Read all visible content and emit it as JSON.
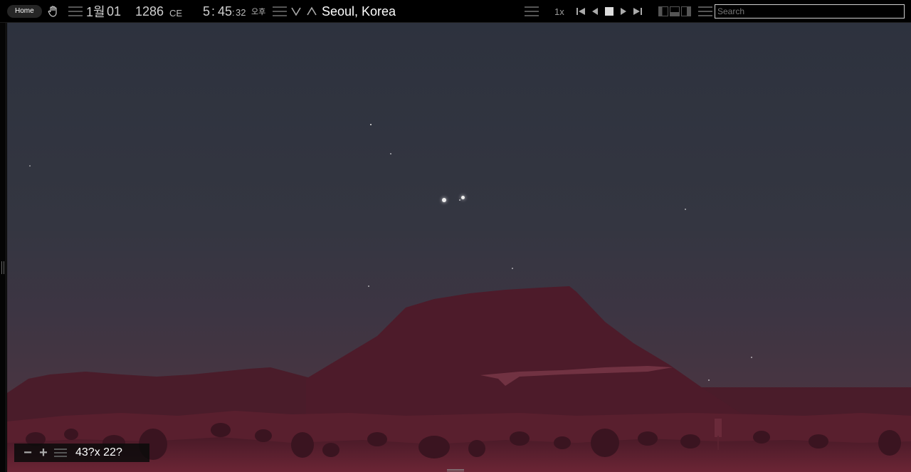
{
  "toolbar": {
    "home_label": "Home",
    "month": "1월",
    "day": "01",
    "year": "1286",
    "era": "CE",
    "hour": "5",
    "minute": "45",
    "second": "32",
    "ampm": "오후",
    "location": "Seoul, Korea",
    "rate": "1x",
    "search_placeholder": "Search"
  },
  "icons": {
    "pan": "hand-icon",
    "menus": "hamburger-icon",
    "down": "chevron-down-icon",
    "up": "chevron-up-icon",
    "transport": [
      "skip-back-icon",
      "step-back-icon",
      "stop-icon",
      "play-icon",
      "skip-forward-icon"
    ],
    "layout": "layout-panels-icon"
  },
  "view": {
    "fov": "43?x 22?"
  },
  "colors": {
    "sky_top": "#2d323e",
    "sky_horizon": "#523441",
    "ground": "#5a1f2d"
  }
}
